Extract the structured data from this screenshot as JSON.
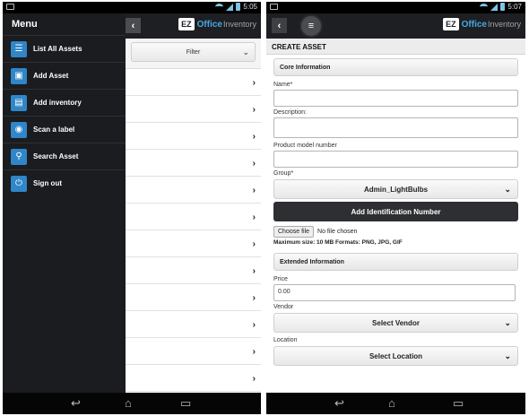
{
  "left": {
    "status": {
      "time": "5:05"
    },
    "drawer": {
      "title": "Menu",
      "items": [
        {
          "label": "List All Assets",
          "icon": "list-icon"
        },
        {
          "label": "Add Asset",
          "icon": "briefcase-icon"
        },
        {
          "label": "Add inventory",
          "icon": "inventory-icon"
        },
        {
          "label": "Scan a label",
          "icon": "camera-icon"
        },
        {
          "label": "Search Asset",
          "icon": "search-icon"
        },
        {
          "label": "Sign out",
          "icon": "power-icon"
        }
      ]
    },
    "header": {
      "logo_ez": "EZ",
      "logo_office": "Office",
      "logo_inventory": "Inventory"
    },
    "filter": {
      "label": "Filter"
    }
  },
  "right": {
    "status": {
      "time": "5:07"
    },
    "header": {
      "logo_ez": "EZ",
      "logo_office": "Office",
      "logo_inventory": "Inventory"
    },
    "page_title": "CREATE ASSET",
    "core_section": "Core Information",
    "fields": {
      "name_label": "Name*",
      "description_label": "Description:",
      "model_label": "Product model number",
      "group_label": "Group*",
      "group_value": "Admin_LightBulbs",
      "add_id_button": "Add Identification Number",
      "choose_file": "Choose file",
      "no_file": "No file chosen",
      "file_note": "Maximum size: 10 MB Formats: PNG, JPG, GIF"
    },
    "extended_section": "Extended Information",
    "extended": {
      "price_label": "Price",
      "price_value": "0.00",
      "vendor_label": "Vendor",
      "vendor_select": "Select Vendor",
      "location_label": "Location",
      "location_select": "Select Location"
    }
  },
  "colors": {
    "accent": "#2f86c8",
    "logo_blue": "#46a6e3",
    "header_bg": "#1e1f22",
    "drawer_bg": "#1b1c1f"
  }
}
